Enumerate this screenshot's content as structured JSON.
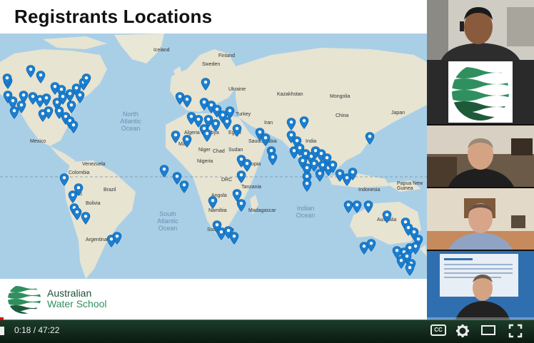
{
  "slide": {
    "title": "Registrants Locations",
    "map": {
      "ocean_labels": [
        {
          "id": "north-atlantic",
          "text": "North\nAtlantic\nOcean"
        },
        {
          "id": "south-atlantic",
          "text": "South\nAtlantic\nOcean"
        },
        {
          "id": "indian",
          "text": "Indian\nOcean"
        }
      ],
      "country_labels": [
        "Iceland",
        "Sweden",
        "Finland",
        "Ukraine",
        "Kazakhstan",
        "Mongolia",
        "Turkey",
        "Iran",
        "China",
        "Japan",
        "Mexico",
        "Algeria",
        "Libya",
        "Egypt",
        "Mali",
        "Niger",
        "Chad",
        "Sudan",
        "Nigeria",
        "Saudi Arabia",
        "India",
        "Ethiopia",
        "Venezuela",
        "Colombia",
        "Brazil",
        "Peru",
        "Bolivia",
        "DRC",
        "Tanzania",
        "Angola",
        "Namibia",
        "South Africa",
        "Madagascar",
        "Argentina",
        "Indonesia",
        "Papua New Guinea",
        "Australia"
      ],
      "pin_color": "#1a7fd1"
    },
    "organization": {
      "line1": "Australian",
      "line2": "Water School"
    }
  },
  "player": {
    "time_current": "0:18",
    "time_separator": " / ",
    "time_total": "47:22",
    "progress_fraction": 0.0063,
    "controls": {
      "captions_label": "CC",
      "settings_icon": "gear-icon",
      "theater_icon": "theater-mode-icon",
      "fullscreen_icon": "fullscreen-icon"
    }
  },
  "colors": {
    "ocean": "#a9cfe7",
    "land": "#e7e4d2",
    "brand_green": "#2f8f5f",
    "progress_red": "#ee0000"
  }
}
